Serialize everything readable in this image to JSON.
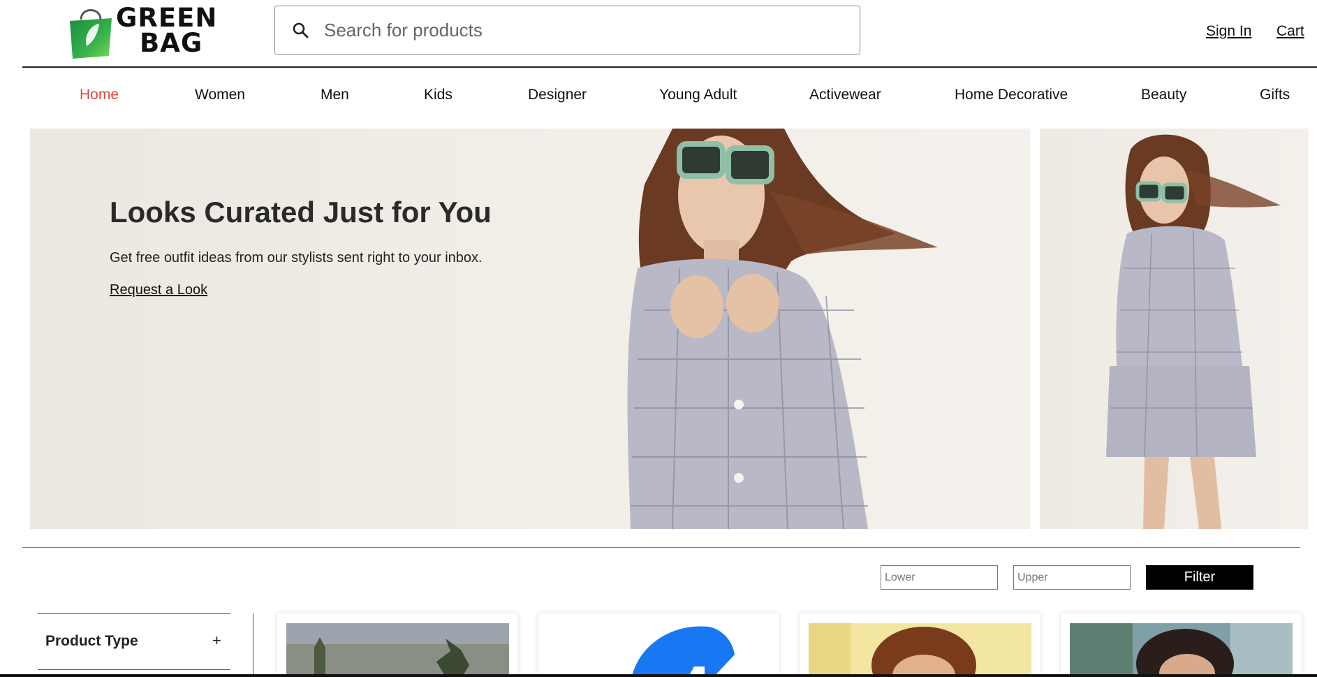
{
  "header": {
    "logo_line1": "GREEN",
    "logo_line2": "BAG",
    "search_placeholder": "Search for products",
    "sign_in": "Sign In",
    "cart": "Cart"
  },
  "nav": {
    "items": [
      {
        "label": "Home",
        "active": true
      },
      {
        "label": "Women"
      },
      {
        "label": "Men"
      },
      {
        "label": "Kids"
      },
      {
        "label": "Designer"
      },
      {
        "label": "Young Adult"
      },
      {
        "label": "Activewear"
      },
      {
        "label": "Home Decorative"
      },
      {
        "label": "Beauty"
      },
      {
        "label": "Gifts"
      }
    ]
  },
  "hero": {
    "title": "Looks Curated Just for You",
    "subtitle": "Get free outfit ideas from our stylists sent right to your inbox.",
    "cta": "Request a Look"
  },
  "filter": {
    "lower_placeholder": "Lower",
    "upper_placeholder": "Upper",
    "button": "Filter"
  },
  "sidebar": {
    "facets": [
      {
        "label": "Product Type",
        "toggle": "+"
      }
    ]
  },
  "colors": {
    "accent_active_nav": "#e0463d",
    "logo_green": "#2e9b3f",
    "filter_button": "#000000"
  }
}
